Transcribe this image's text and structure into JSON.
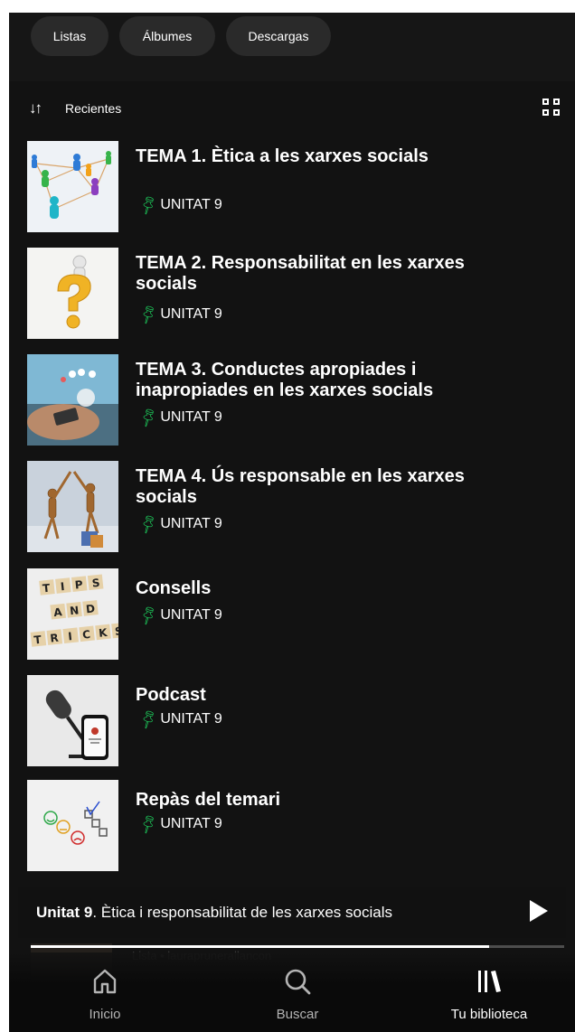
{
  "filters": [
    "Listas",
    "Álbumes",
    "Descargas"
  ],
  "sort": {
    "label": "Recientes",
    "icon": "sort-arrows-icon",
    "view_icon": "grid-view-icon"
  },
  "items": [
    {
      "title": "TEMA 1. Ètica a les xarxes socials",
      "subtitle": "UNITAT 9",
      "pinned": true,
      "thumb_icon": "network-people-image"
    },
    {
      "title": "TEMA 2. Responsabilitat en les xarxes socials",
      "subtitle": "UNITAT 9",
      "pinned": true,
      "thumb_icon": "question-mark-image"
    },
    {
      "title": "TEMA 3. Conductes apropiades i inapropiades en les xarxes socials",
      "subtitle": "UNITAT 9",
      "pinned": true,
      "thumb_icon": "hand-phone-image"
    },
    {
      "title": "TEMA 4. Ús responsable en les xarxes socials",
      "subtitle": "UNITAT 9",
      "pinned": true,
      "thumb_icon": "wooden-figures-image"
    },
    {
      "title": "Consells",
      "subtitle": "UNITAT 9",
      "pinned": true,
      "thumb_icon": "tips-tricks-image"
    },
    {
      "title": "Podcast",
      "subtitle": "UNITAT 9",
      "pinned": true,
      "thumb_icon": "microphone-image"
    },
    {
      "title": "Repàs del temari",
      "subtitle": "UNITAT 9",
      "pinned": true,
      "thumb_icon": "smiley-checklist-image"
    }
  ],
  "now_playing": {
    "bold": "Unitat 9",
    "rest": ". Ètica i responsabilitat de les xarxes socials",
    "progress": 0.86
  },
  "ghost_item": {
    "text": "Lista • lauraprunerallancon"
  },
  "nav": [
    {
      "label": "Inicio",
      "icon": "home-icon",
      "active": false
    },
    {
      "label": "Buscar",
      "icon": "search-icon",
      "active": false
    },
    {
      "label": "Tu biblioteca",
      "icon": "library-icon",
      "active": true
    }
  ],
  "colors": {
    "background": "#121212",
    "accent": "#1ed760",
    "inactive_nav": "#b3b3b3"
  }
}
